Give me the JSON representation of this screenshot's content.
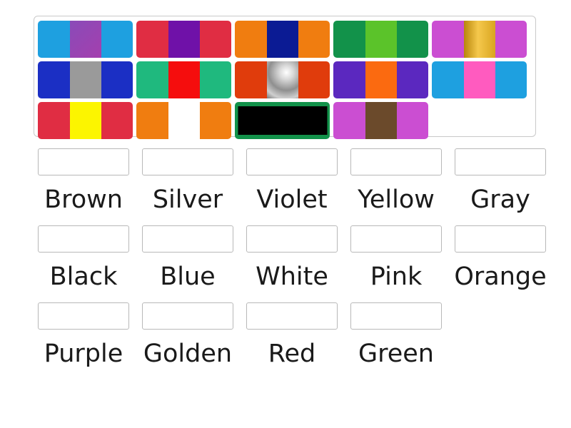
{
  "activity": {
    "type": "match-up-color-tiles",
    "tile_bank": {
      "rows": [
        [
          {
            "name": "violet-tile",
            "bg": "#1ea0e0",
            "swatch": "violet",
            "swatch_color": "#9b3fb5",
            "gradient": "linear-gradient(135deg,#8a4bb8,#a43fae)",
            "full": false
          },
          {
            "name": "purple-tile",
            "bg": "#e02d43",
            "swatch": "purple",
            "swatch_color": "#6f11a8",
            "gradient": "",
            "full": false
          },
          {
            "name": "blue-tile",
            "bg": "#f07d10",
            "swatch": "blue",
            "swatch_color": "#0b1b94",
            "gradient": "",
            "full": false
          },
          {
            "name": "green-tile",
            "bg": "#12924a",
            "swatch": "green",
            "swatch_color": "#5bc32a",
            "gradient": "",
            "full": false
          },
          {
            "name": "golden-tile",
            "bg": "#cb4ed2",
            "swatch": "golden",
            "swatch_color": "#d4a017",
            "gradient": "linear-gradient(90deg,#b8860b,#f5c84c 45%,#d9a520)",
            "full": false
          }
        ],
        [
          {
            "name": "gray-tile",
            "bg": "#1b2fc4",
            "swatch": "gray",
            "swatch_color": "#9a9a9a",
            "gradient": "",
            "full": false
          },
          {
            "name": "red-tile",
            "bg": "#1fb97e",
            "swatch": "red",
            "swatch_color": "#f50d0d",
            "gradient": "",
            "full": false
          },
          {
            "name": "silver-tile",
            "bg": "#e03c0c",
            "swatch": "silver",
            "swatch_color": "#bdbdbd",
            "gradient": "radial-gradient(circle at 62% 30%, #ffffff 0%, #d8d8d8 22%, #8f8f8f 55%, #cfcfcf 80%, #787878 100%)",
            "full": false
          },
          {
            "name": "orange-tile",
            "bg": "#5b28bf",
            "swatch": "orange",
            "swatch_color": "#fb6a10",
            "gradient": "",
            "full": false
          },
          {
            "name": "pink-tile",
            "bg": "#1ea0e0",
            "swatch": "pink",
            "swatch_color": "#ff5bbf",
            "gradient": "",
            "full": false
          }
        ],
        [
          {
            "name": "yellow-tile",
            "bg": "#e02d43",
            "swatch": "yellow",
            "swatch_color": "#fcf500",
            "gradient": "",
            "full": false
          },
          {
            "name": "white-tile",
            "bg": "#f07d10",
            "swatch": "white",
            "swatch_color": "#ffffff",
            "gradient": "",
            "full": false
          },
          {
            "name": "black-tile",
            "bg": "#12924a",
            "swatch": "black",
            "swatch_color": "#000000",
            "gradient": "",
            "full": true
          },
          {
            "name": "brown-tile",
            "bg": "#cb4ed2",
            "swatch": "brown",
            "swatch_color": "#6b4a2b",
            "gradient": "",
            "full": false
          },
          {
            "name": "empty-slot",
            "bg": "",
            "swatch": "",
            "swatch_color": "",
            "gradient": "",
            "full": false,
            "empty": true
          }
        ]
      ]
    },
    "answers": {
      "rows": [
        [
          {
            "label": "Brown",
            "box_value": ""
          },
          {
            "label": "Silver",
            "box_value": ""
          },
          {
            "label": "Violet",
            "box_value": ""
          },
          {
            "label": "Yellow",
            "box_value": ""
          },
          {
            "label": "Gray",
            "box_value": ""
          }
        ],
        [
          {
            "label": "Black",
            "box_value": ""
          },
          {
            "label": "Blue",
            "box_value": ""
          },
          {
            "label": "White",
            "box_value": ""
          },
          {
            "label": "Pink",
            "box_value": ""
          },
          {
            "label": "Orange",
            "box_value": ""
          }
        ],
        [
          {
            "label": "Purple",
            "box_value": ""
          },
          {
            "label": "Golden",
            "box_value": ""
          },
          {
            "label": "Red",
            "box_value": ""
          },
          {
            "label": "Green",
            "box_value": ""
          }
        ]
      ]
    },
    "colors": {
      "container_border": "#c9c9c9",
      "box_border": "#b8b8b8",
      "label_text": "#1a1a1a",
      "page_background": "#ffffff"
    }
  }
}
